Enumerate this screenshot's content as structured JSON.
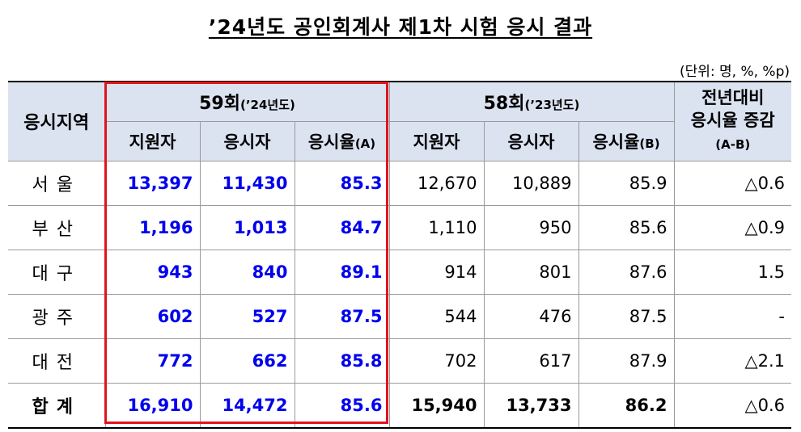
{
  "title": "’24년도 공인회계사 제1차 시험 응시 결과",
  "unit": "(단위: 명, %, %p)",
  "header": {
    "region": "응시지역",
    "group59": "59회",
    "group59_year": "(’24년도)",
    "group58": "58회",
    "group58_year": "(’23년도)",
    "change_line1": "전년대비",
    "change_line2": "응시율 증감",
    "change_line3": "(A-B)",
    "applicants": "지원자",
    "examinees": "응시자",
    "rate": "응시율",
    "rate_a": "(A)",
    "rate_b": "(B)"
  },
  "rows": [
    {
      "region": "서울",
      "a59": "13,397",
      "e59": "11,430",
      "r59": "85.3",
      "a58": "12,670",
      "e58": "10,889",
      "r58": "85.9",
      "diff": "△0.6"
    },
    {
      "region": "부산",
      "a59": "1,196",
      "e59": "1,013",
      "r59": "84.7",
      "a58": "1,110",
      "e58": "950",
      "r58": "85.6",
      "diff": "△0.9"
    },
    {
      "region": "대구",
      "a59": "943",
      "e59": "840",
      "r59": "89.1",
      "a58": "914",
      "e58": "801",
      "r58": "87.6",
      "diff": "1.5"
    },
    {
      "region": "광주",
      "a59": "602",
      "e59": "527",
      "r59": "87.5",
      "a58": "544",
      "e58": "476",
      "r58": "87.5",
      "diff": "-"
    },
    {
      "region": "대전",
      "a59": "772",
      "e59": "662",
      "r59": "85.8",
      "a58": "702",
      "e58": "617",
      "r58": "87.9",
      "diff": "△2.1"
    }
  ],
  "total": {
    "region": "합계",
    "a59": "16,910",
    "e59": "14,472",
    "r59": "85.6",
    "a58": "15,940",
    "e58": "13,733",
    "r58": "86.2",
    "diff": "△0.6"
  },
  "colors": {
    "header_bg": "#dbe3f1",
    "highlight_text": "#0000ee",
    "highlight_border": "#e0141e"
  }
}
